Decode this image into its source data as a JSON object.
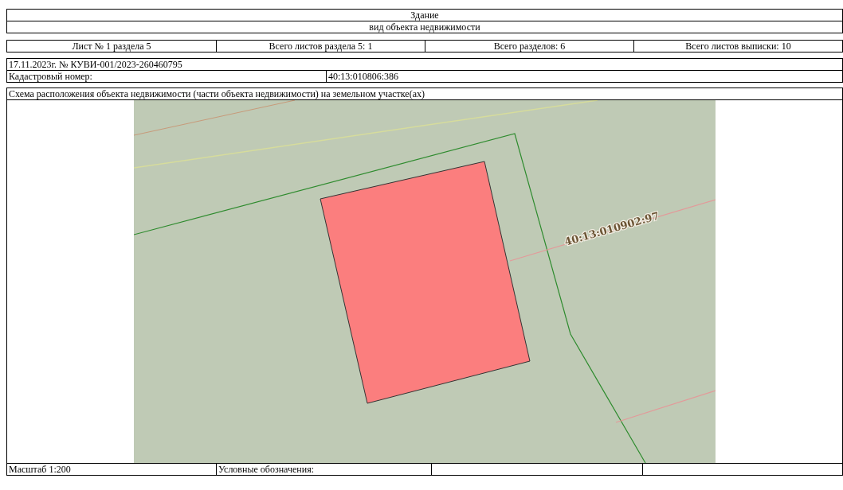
{
  "header": {
    "object_type": "Здание",
    "object_type_caption": "вид объекта недвижимости"
  },
  "sheet_info": [
    "Лист № 1 раздела 5",
    "Всего листов раздела 5: 1",
    "Всего разделов: 6",
    "Всего листов выписки: 10"
  ],
  "extract": {
    "number": "17.11.2023г. № КУВИ-001/2023-260460795",
    "cadastral_label": "Кадастровый номер:",
    "cadastral_number": "40:13:010806:386"
  },
  "scheme": {
    "title": "Схема расположения объекта недвижимости (части объекта недвижимости) на земельном участке(ах)",
    "map_labels": [
      "40:13:010902:97"
    ]
  },
  "footer": {
    "scale": "Масштаб 1:200",
    "legend_title": "Условные обозначения:"
  }
}
